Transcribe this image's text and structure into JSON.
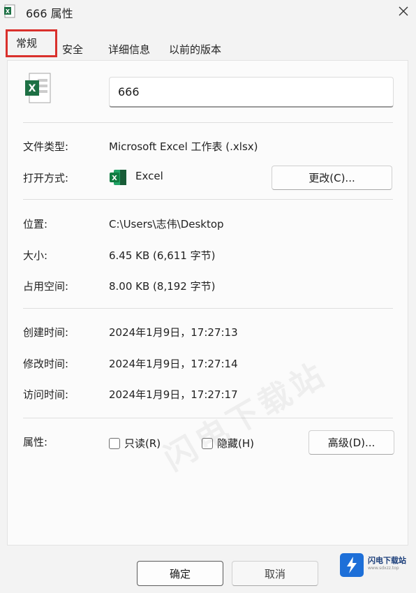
{
  "window": {
    "title": "666 属性"
  },
  "tabs": [
    {
      "label": "常规"
    },
    {
      "label": "安全"
    },
    {
      "label": "详细信息"
    },
    {
      "label": "以前的版本"
    }
  ],
  "general": {
    "file_name": "666",
    "file_type_label": "文件类型:",
    "file_type_value": "Microsoft Excel 工作表 (.xlsx)",
    "opens_with_label": "打开方式:",
    "opens_with_value": "Excel",
    "change_button": "更改(C)...",
    "location_label": "位置:",
    "location_value": "C:\\Users\\志伟\\Desktop",
    "size_label": "大小:",
    "size_value": "6.45 KB (6,611 字节)",
    "size_on_disk_label": "占用空间:",
    "size_on_disk_value": "8.00 KB (8,192 字节)",
    "created_label": "创建时间:",
    "created_value": "2024年1月9日，17:27:13",
    "modified_label": "修改时间:",
    "modified_value": "2024年1月9日，17:27:14",
    "accessed_label": "访问时间:",
    "accessed_value": "2024年1月9日，17:27:17",
    "attributes_label": "属性:",
    "readonly_label": "只读(R)",
    "hidden_label": "隐藏(H)",
    "advanced_button": "高级(D)..."
  },
  "footer": {
    "ok_button": "确定",
    "cancel_button": "取消"
  },
  "watermark_logo": {
    "name": "闪电下载站",
    "url": "www.sdxzz.top"
  },
  "colors": {
    "excel_green": "#1d7044",
    "highlight_red": "#d9302c",
    "logo_blue": "#1d6fd8"
  }
}
